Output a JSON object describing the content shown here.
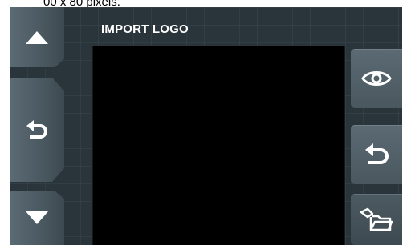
{
  "caption": "00 x 80 pixels.",
  "screen": {
    "title": "IMPORT LOGO"
  },
  "buttons": {
    "left": [
      {
        "icon": "arrow-up-icon"
      },
      {
        "icon": "back-arrow-icon"
      },
      {
        "icon": "arrow-down-icon"
      }
    ],
    "right": [
      {
        "icon": "eye-icon"
      },
      {
        "icon": "undo-arrow-icon"
      },
      {
        "icon": "folder-open-icon"
      }
    ]
  },
  "colors": {
    "screen_bg": "#2a343b",
    "button_face": "#4a575f",
    "preview_bg": "#000000",
    "icon": "#ffffff"
  }
}
